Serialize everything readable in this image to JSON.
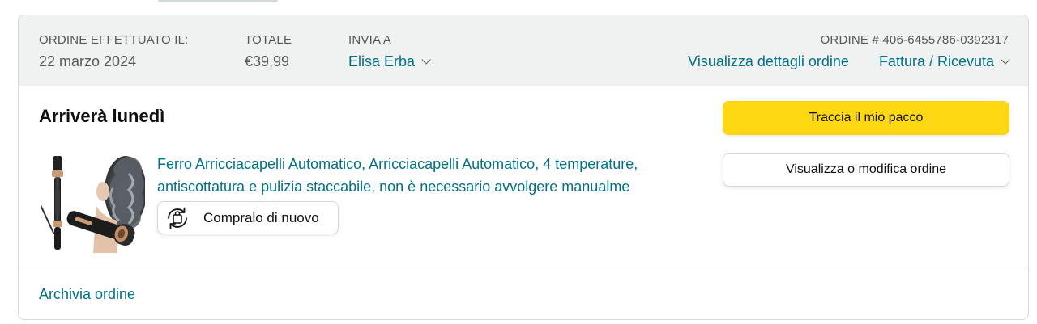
{
  "header": {
    "order_placed_label": "ORDINE EFFETTUATO IL:",
    "order_placed_value": "22 marzo 2024",
    "total_label": "TOTALE",
    "total_value": "€39,99",
    "ship_to_label": "INVIA A",
    "ship_to_value": "Elisa Erba",
    "order_number": "ORDINE # 406-6455786-0392317",
    "view_details_link": "Visualizza dettagli ordine",
    "invoice_link": "Fattura / Ricevuta"
  },
  "shipment": {
    "status": "Arriverà lunedì",
    "product_title": "Ferro Arricciacapelli Automatico, Arricciacapelli Automatico, 4 temperature, antiscottatura e pulizia staccabile, non è necessario avvolgere manualme",
    "buy_again_label": "Compralo di nuovo"
  },
  "actions": {
    "track_package": "Traccia il mio pacco",
    "view_or_edit": "Visualizza o modifica ordine"
  },
  "footer": {
    "archive_link": "Archivia ordine"
  },
  "colors": {
    "link": "#007185",
    "primary_button": "#ffd814",
    "header_bg": "#f0f2f2",
    "border": "#d5d9d9"
  },
  "icons": {
    "ship_to_dropdown": "chevron-down-icon",
    "invoice_dropdown": "chevron-down-icon",
    "buy_again": "buy-again-icon"
  }
}
